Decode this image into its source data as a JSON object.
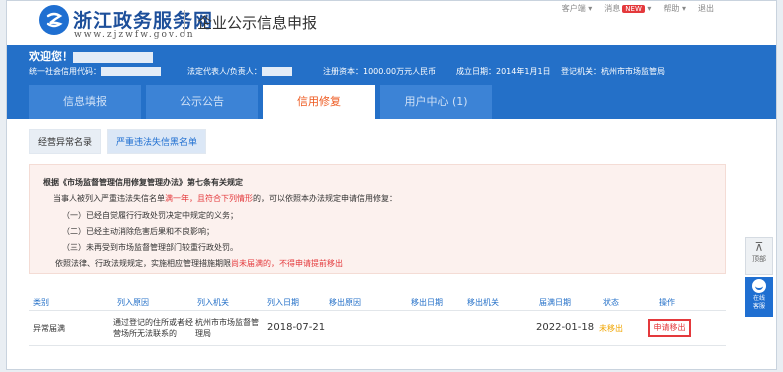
{
  "header": {
    "site_name": "浙江政务服务网",
    "site_url": "www.zjzwfw.gov.cn",
    "page_title": "企业公示信息申报",
    "links": {
      "customer": "客户端 ▾",
      "messages": "消息",
      "messages_badge": "NEW",
      "messages_arrow": "▾",
      "help": "帮助 ▾",
      "logout": "退出"
    }
  },
  "banner": {
    "welcome": "欢迎您！",
    "credit_code_label": "统一社会信用代码：",
    "legal_rep_label": "法定代表人/负责人：",
    "capital": "注册资本：1000.00万元人民币",
    "established": "成立日期：2014年1月1日",
    "authority": "登记机关：杭州市市场监管局"
  },
  "tabs": [
    {
      "label": "信息填报"
    },
    {
      "label": "公示公告"
    },
    {
      "label": "信用修复"
    },
    {
      "label": "用户中心 (1)"
    }
  ],
  "subtabs": [
    {
      "label": "经营异常名录"
    },
    {
      "label": "严重违法失信黑名单"
    }
  ],
  "notice": {
    "title": "根据《市场监督管理信用修复管理办法》第七条有关规定",
    "para_a": "当事人被列入严重违法失信名单",
    "para_red": "满一年，且符合下列情形",
    "para_b": "的，可以依照本办法规定申请信用修复：",
    "items": [
      "（一）已经自觉履行行政处罚决定中规定的义务；",
      "（二）已经主动消除危害后果和不良影响；",
      "（三）未再受到市场监督管理部门较重行政处罚。"
    ],
    "footer_a": "依照法律、行政法规规定，实施相应管理措施期限",
    "footer_red": "尚未届满的，不得申请提前移出"
  },
  "table": {
    "headers": [
      "类别",
      "列入原因",
      "列入机关",
      "列入日期",
      "移出原因",
      "移出日期",
      "移出机关",
      "届满日期",
      "状态",
      "操作"
    ],
    "rows": [
      {
        "category": "异常届满",
        "reason": "通过登记的住所或者经营场所无法联系的",
        "authority": "杭州市市场监督管理局",
        "date_in": "2018-07-21",
        "reason_out": "",
        "date_out": "",
        "authority_out": "",
        "expiry": "2022-01-18",
        "status": "未移出",
        "action": "申请移出"
      }
    ]
  },
  "side": {
    "top_label": "顶部",
    "top_arrow": "⊼",
    "service_label_1": "在线",
    "service_label_2": "客服"
  },
  "colors": {
    "brand_blue": "#2470c8",
    "active_tab_text": "#ee5a20",
    "alert_red": "#e4393c",
    "status_orange": "#f0a500"
  }
}
